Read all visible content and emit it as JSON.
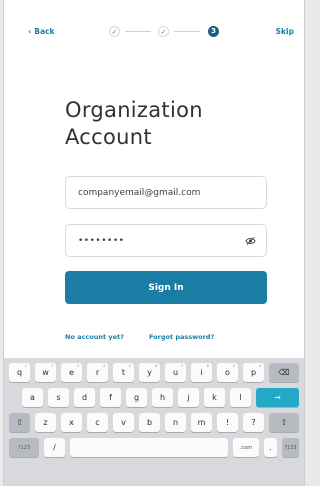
{
  "nav": {
    "back_label": "Back",
    "skip_label": "Skip",
    "steps": [
      {
        "state": "done",
        "label": "✓"
      },
      {
        "state": "done",
        "label": "✓"
      },
      {
        "state": "active",
        "label": "3"
      }
    ]
  },
  "page": {
    "title_line1": "Organization",
    "title_line2": "Account"
  },
  "form": {
    "email_value": "companyemail@gmail.com",
    "password_mask": "••••••••",
    "signin_label": "Sign In"
  },
  "links": {
    "no_account": "No account yet?",
    "forgot_password": "Forgot password?"
  },
  "keyboard": {
    "row1": [
      "q",
      "w",
      "e",
      "r",
      "t",
      "y",
      "u",
      "i",
      "o",
      "p"
    ],
    "row1_sup": [
      "1",
      "2",
      "3",
      "4",
      "5",
      "6",
      "7",
      "8",
      "9",
      "0"
    ],
    "row2": [
      "a",
      "s",
      "d",
      "f",
      "g",
      "h",
      "j",
      "k",
      "l"
    ],
    "row3": [
      "z",
      "x",
      "c",
      "v",
      "b",
      "n",
      "m",
      "!",
      "?"
    ],
    "row4": {
      "numbers": "?123",
      "slash": "/",
      "com": ".com",
      "dot": ".",
      "numbers_right": "?123"
    },
    "backspace_icon": "⌫",
    "shift_icon": "⇧",
    "enter_icon": "→"
  },
  "colors": {
    "accent": "#1b7da4",
    "step_active": "#15607c",
    "enter_key": "#23a9c6"
  }
}
